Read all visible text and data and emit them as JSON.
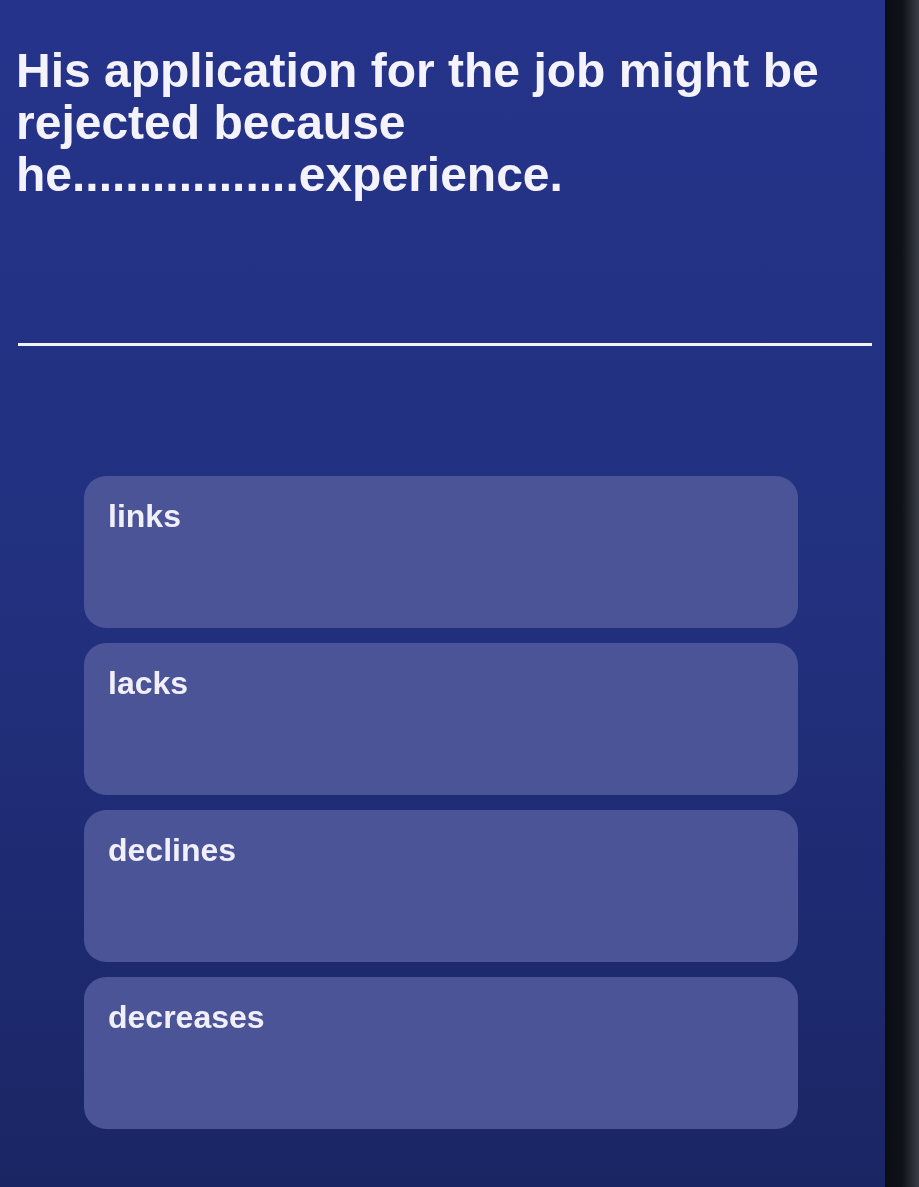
{
  "question": {
    "text": "His application for the job might be rejected because he.................experience."
  },
  "options": [
    {
      "label": "links",
      "selected": false
    },
    {
      "label": "lacks",
      "selected": false
    },
    {
      "label": "declines",
      "selected": false
    },
    {
      "label": "decreases",
      "selected": false
    }
  ]
}
